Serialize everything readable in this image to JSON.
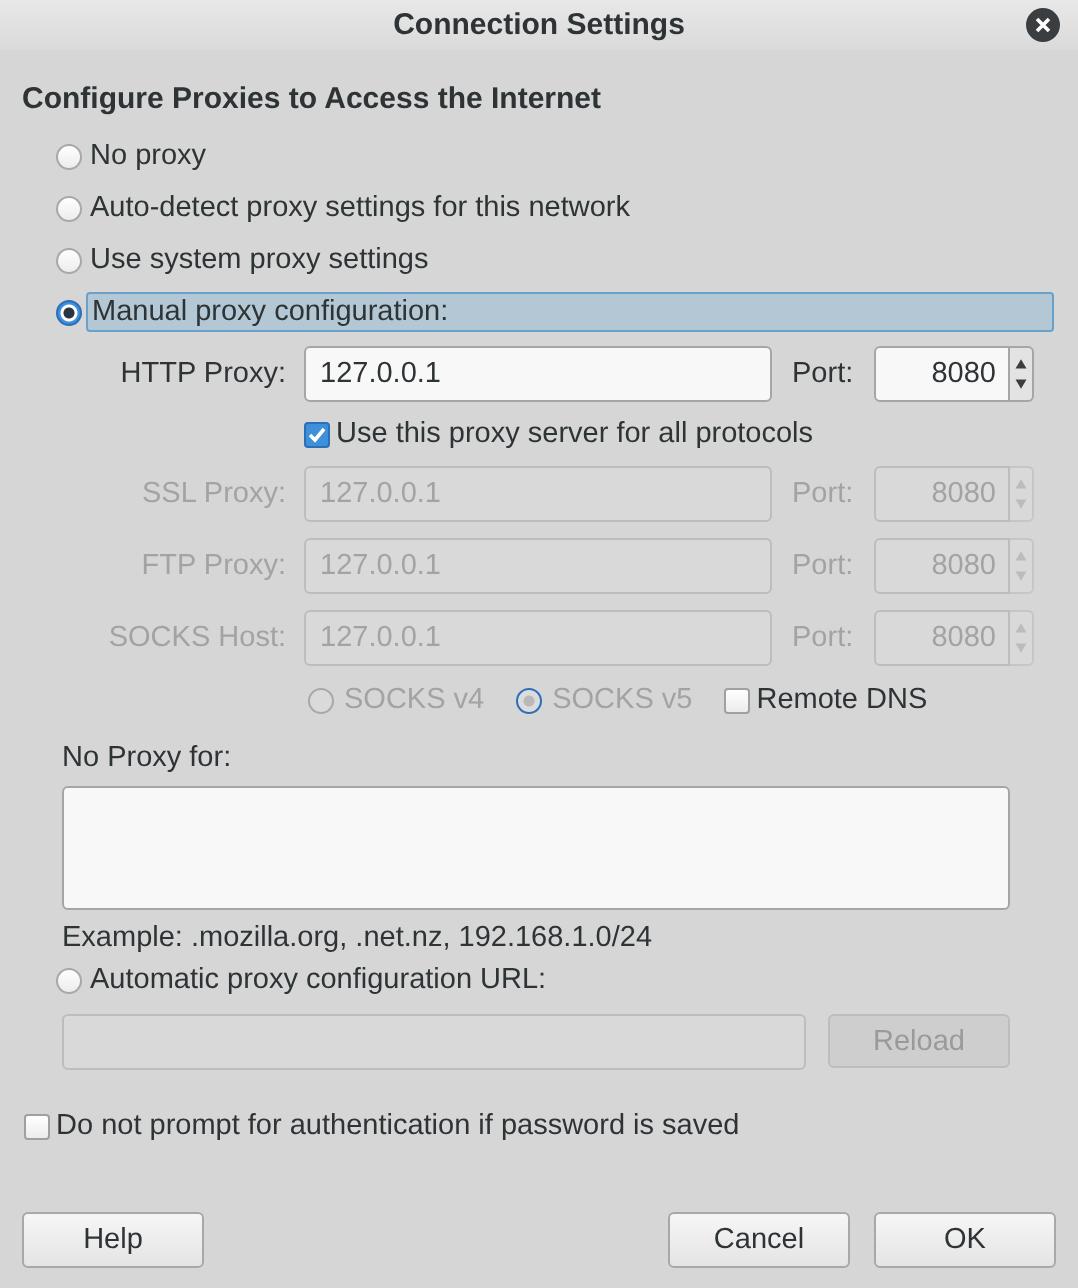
{
  "window": {
    "title": "Connection Settings"
  },
  "heading": "Configure Proxies to Access the Internet",
  "proxy_modes": [
    {
      "label": "No proxy",
      "selected": false
    },
    {
      "label": "Auto-detect proxy settings for this network",
      "selected": false
    },
    {
      "label": "Use system proxy settings",
      "selected": false
    },
    {
      "label": "Manual proxy configuration:",
      "selected": true
    }
  ],
  "manual": {
    "proxies": [
      {
        "label": "HTTP Proxy:",
        "value": "127.0.0.1",
        "port_label": "Port:",
        "port": "8080",
        "disabled": false
      },
      {
        "label": "SSL Proxy:",
        "value": "127.0.0.1",
        "port_label": "Port:",
        "port": "8080",
        "disabled": true
      },
      {
        "label": "FTP Proxy:",
        "value": "127.0.0.1",
        "port_label": "Port:",
        "port": "8080",
        "disabled": true
      },
      {
        "label": "SOCKS Host:",
        "value": "127.0.0.1",
        "port_label": "Port:",
        "port": "8080",
        "disabled": true
      }
    ],
    "share_all": {
      "label": "Use this proxy server for all protocols",
      "checked": true
    },
    "socks_versions": [
      {
        "label": "SOCKS v4",
        "selected": false,
        "disabled": true
      },
      {
        "label": "SOCKS v5",
        "selected": true,
        "disabled": true
      }
    ],
    "remote_dns": {
      "label": "Remote DNS",
      "checked": false
    }
  },
  "no_proxy": {
    "label": "No Proxy for:",
    "example": "Example: .mozilla.org, .net.nz, 192.168.1.0/24"
  },
  "auto_url": {
    "label": "Automatic proxy configuration URL:",
    "selected": false,
    "disabled": true,
    "reload": "Reload"
  },
  "no_prompt": {
    "label": "Do not prompt for authentication if password is saved",
    "checked": false
  },
  "buttons": [
    {
      "label": "Help",
      "kind": "left"
    },
    {
      "label": "Cancel",
      "kind": "right"
    },
    {
      "label": "OK",
      "kind": "right"
    }
  ]
}
